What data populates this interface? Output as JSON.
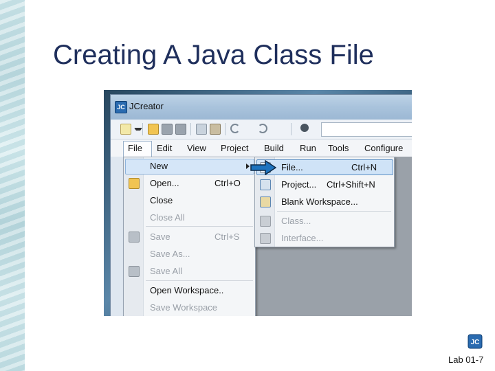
{
  "slide": {
    "title": "Creating A Java Class File",
    "page_number": "Lab 01-7",
    "logo_text": "JC"
  },
  "window": {
    "icon_text": "JC",
    "title": "JCreator"
  },
  "menubar": {
    "items": [
      "File",
      "Edit",
      "View",
      "Project",
      "Build",
      "Run",
      "Tools",
      "Configure"
    ]
  },
  "file_menu": {
    "items": [
      {
        "label": "New",
        "shortcut": "",
        "enabled": true,
        "highlighted": true,
        "submenu": true
      },
      {
        "label": "Open...",
        "shortcut": "Ctrl+O",
        "enabled": true
      },
      {
        "label": "Close",
        "shortcut": "",
        "enabled": true
      },
      {
        "label": "Close All",
        "shortcut": "",
        "enabled": false
      },
      {
        "label": "Save",
        "shortcut": "Ctrl+S",
        "enabled": false
      },
      {
        "label": "Save As...",
        "shortcut": "",
        "enabled": false
      },
      {
        "label": "Save All",
        "shortcut": "",
        "enabled": false
      },
      {
        "label": "Open Workspace..",
        "shortcut": "",
        "enabled": true
      },
      {
        "label": "Save Workspace",
        "shortcut": "",
        "enabled": false
      }
    ]
  },
  "new_submenu": {
    "items": [
      {
        "label": "File...",
        "shortcut": "Ctrl+N",
        "enabled": true,
        "highlighted": true
      },
      {
        "label": "Project...",
        "shortcut": "Ctrl+Shift+N",
        "enabled": true
      },
      {
        "label": "Blank Workspace...",
        "shortcut": "",
        "enabled": true
      },
      {
        "label": "Class...",
        "shortcut": "",
        "enabled": false
      },
      {
        "label": "Interface...",
        "shortcut": "",
        "enabled": false
      }
    ]
  },
  "colors": {
    "title": "#1f2f5c",
    "highlight": "#d5e6f8",
    "pointer_arrow": "#1e73be"
  }
}
